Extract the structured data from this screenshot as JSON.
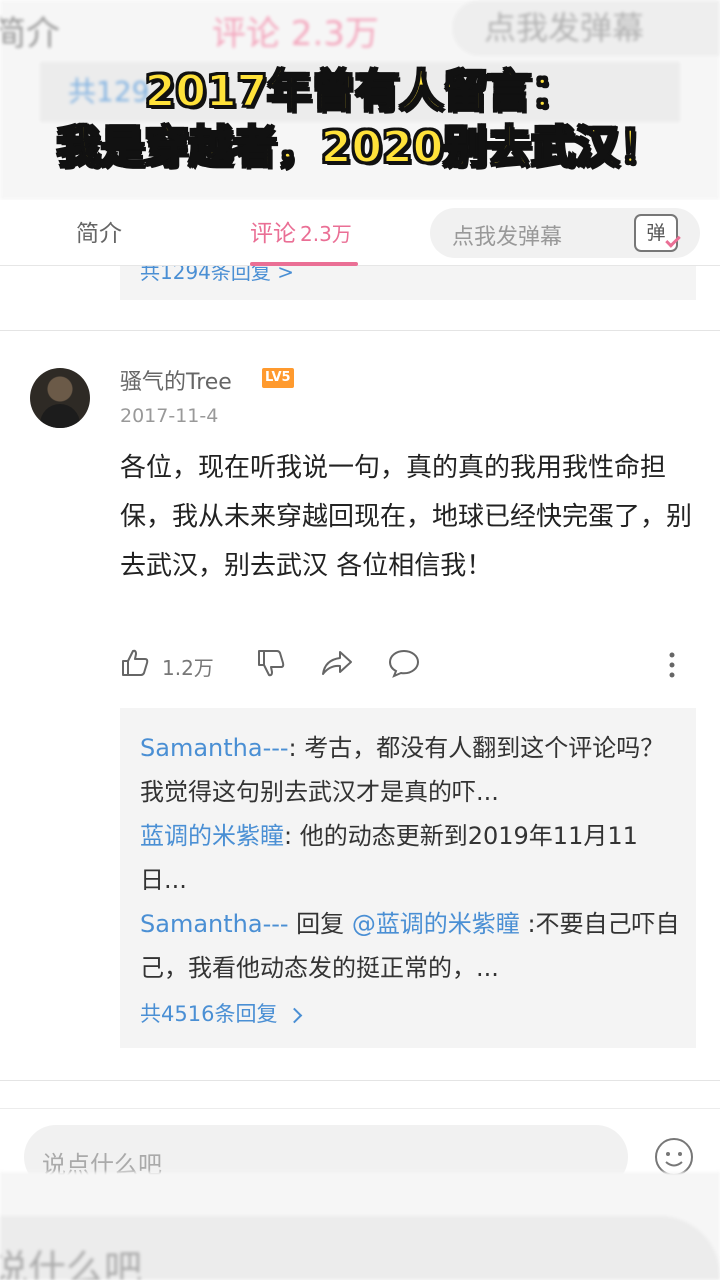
{
  "overlay": {
    "line1": "2017年曾有人留言：",
    "line2": "我是穿越者，2020别去武汉！"
  },
  "ghost": {
    "intro": "简介",
    "comments": "评论 2.3万",
    "danmu": "点我发弹幕",
    "partial": "共129",
    "bottom_placeholder": "说什么吧"
  },
  "tabs": {
    "intro": "简介",
    "comments_label": "评论",
    "comments_count": "2.3万",
    "danmu_placeholder": "点我发弹幕",
    "danmu_button": "弹"
  },
  "prev_reply": "共1294条回复 >",
  "comment": {
    "username": "骚气的Tree",
    "level": "LV5",
    "date": "2017-11-4",
    "text": "各位，现在听我说一句，真的真的我用我性命担保，我从未来穿越回现在，地球已经快完蛋了，别去武汉，别去武汉 各位相信我！",
    "likes": "1.2万"
  },
  "replies": [
    {
      "nick": "Samantha---",
      "sep": ": ",
      "text": "考古，都没有人翻到这个评论吗？我觉得这句别去武汉才是真的吓..."
    },
    {
      "nick": "蓝调的米紫瞳",
      "sep": ": ",
      "text": "他的动态更新到2019年11月11日..."
    },
    {
      "nick": "Samantha---",
      "sep": " 回复 ",
      "mention": "@蓝调的米紫瞳",
      "text": " :不要自己吓自己，我看他动态发的挺正常的，..."
    }
  ],
  "more_replies": "共4516条回复",
  "bottom": {
    "placeholder": "说点什么吧"
  },
  "colors": {
    "accent": "#ea6f95",
    "link": "#4a8fd4",
    "overlay": "#ffe23a"
  }
}
